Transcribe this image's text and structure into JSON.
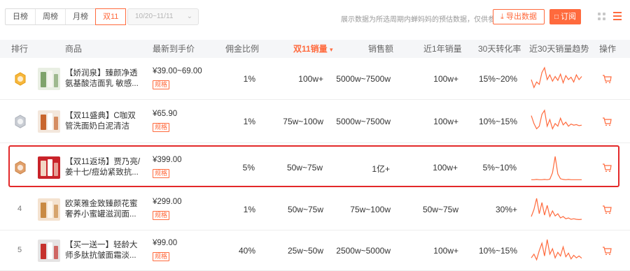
{
  "toolbar": {
    "tabs": [
      {
        "label": "日榜",
        "active": false
      },
      {
        "label": "周榜",
        "active": false
      },
      {
        "label": "月榜",
        "active": false
      },
      {
        "label": "双11",
        "active": true
      }
    ],
    "date_range": "10/20~11/11",
    "hint": "展示数据为所选周期内蝉妈妈的预估数据，仅供参考",
    "export_label": "导出数据",
    "subscribe_label": "订阅",
    "accent_color": "#ff6a3d"
  },
  "table": {
    "columns": [
      "排行",
      "商品",
      "最新到手价",
      "佣金比例",
      "双11销量",
      "销售额",
      "近1年销量",
      "30天转化率",
      "近30天销量趋势",
      "操作"
    ],
    "sort_indicator": "▾",
    "rows": [
      {
        "rank": "",
        "rank_badge": "gold-medal",
        "name": "【娇润泉】臻颜净透氨基酸洁面乳 敏感...",
        "price": "¥39.00~69.00",
        "spec": "规格",
        "commission": "1%",
        "d11_sales": "100w+",
        "revenue": "5000w~7500w",
        "year_sales": "100w+",
        "conversion": "15%~20%",
        "trend": [
          30,
          10,
          24,
          18,
          48,
          60,
          30,
          42,
          26,
          38,
          28,
          44,
          22,
          40,
          30,
          36,
          24,
          42,
          30,
          38
        ]
      },
      {
        "rank": "",
        "rank_badge": "silver-medal",
        "name": "【双11盛典】C咖双管洗面奶白泥清洁氨...",
        "price": "¥65.90",
        "spec": "规格",
        "commission": "1%",
        "d11_sales": "75w~100w",
        "revenue": "5000w~7500w",
        "year_sales": "100w+",
        "conversion": "10%~15%",
        "trend": [
          70,
          40,
          20,
          30,
          75,
          90,
          30,
          55,
          20,
          40,
          30,
          60,
          35,
          45,
          30,
          38,
          34,
          36,
          32,
          34
        ]
      },
      {
        "rank": "",
        "rank_badge": "bronze-medal",
        "name": "【双11返场】贾乃亮/姜十七/痘幼紧致抗...",
        "price": "¥399.00",
        "spec": "规格",
        "commission": "5%",
        "d11_sales": "50w~75w",
        "revenue": "1亿+",
        "year_sales": "100w+",
        "conversion": "5%~10%",
        "trend": [
          2,
          2,
          3,
          2,
          2,
          3,
          2,
          4,
          30,
          95,
          25,
          6,
          3,
          2,
          3,
          2,
          2,
          2,
          2,
          2
        ]
      },
      {
        "rank": "4",
        "rank_badge": "",
        "name": "欧莱雅金致臻颜花蜜奢养小蜜罐滋润面...",
        "price": "¥299.00",
        "spec": "规格",
        "commission": "1%",
        "d11_sales": "50w~75w",
        "revenue": "75w~100w",
        "year_sales": "50w~75w",
        "conversion": "30%+",
        "trend": [
          20,
          45,
          85,
          30,
          70,
          25,
          60,
          20,
          40,
          22,
          30,
          15,
          20,
          12,
          15,
          10,
          12,
          10,
          9,
          10
        ]
      },
      {
        "rank": "5",
        "rank_badge": "",
        "name": "【买一送一】轻龄大师多肽抗皱面霜淡...",
        "price": "¥99.00",
        "spec": "规格",
        "commission": "40%",
        "d11_sales": "25w~50w",
        "revenue": "2500w~5000w",
        "year_sales": "100w+",
        "conversion": "10%~15%",
        "trend": [
          15,
          25,
          10,
          35,
          55,
          20,
          65,
          25,
          40,
          15,
          30,
          20,
          45,
          18,
          28,
          12,
          22,
          15,
          20,
          14
        ]
      }
    ]
  }
}
